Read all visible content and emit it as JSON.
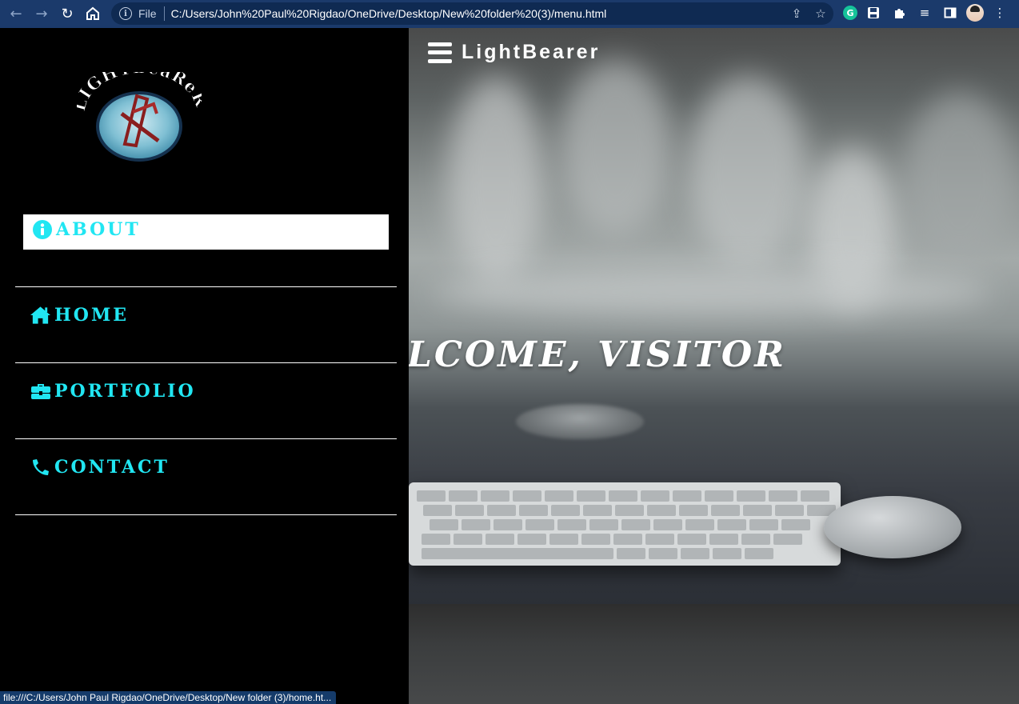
{
  "browser": {
    "file_label": "File",
    "url": "C:/Users/John%20Paul%20Rigdao/OneDrive/Desktop/New%20folder%20(3)/menu.html",
    "status_url": "file:///C:/Users/John Paul Rigdao/OneDrive/Desktop/New folder (3)/home.ht..."
  },
  "header": {
    "brand": "LightBearer"
  },
  "hero": {
    "welcome": "WELCOME, VISITOR"
  },
  "sidebar": {
    "logo_text": "LightBearer",
    "items": [
      {
        "label": "ABOUT",
        "icon": "info-icon",
        "active": true
      },
      {
        "label": "HOME",
        "icon": "home-icon",
        "active": false
      },
      {
        "label": "PORTFOLIO",
        "icon": "briefcase-icon",
        "active": false
      },
      {
        "label": "CONTACT",
        "icon": "phone-icon",
        "active": false
      }
    ]
  },
  "colors": {
    "menu_text": "#21e6f2",
    "sidebar_bg": "#000000",
    "chrome_bg": "#1b3a6b"
  }
}
